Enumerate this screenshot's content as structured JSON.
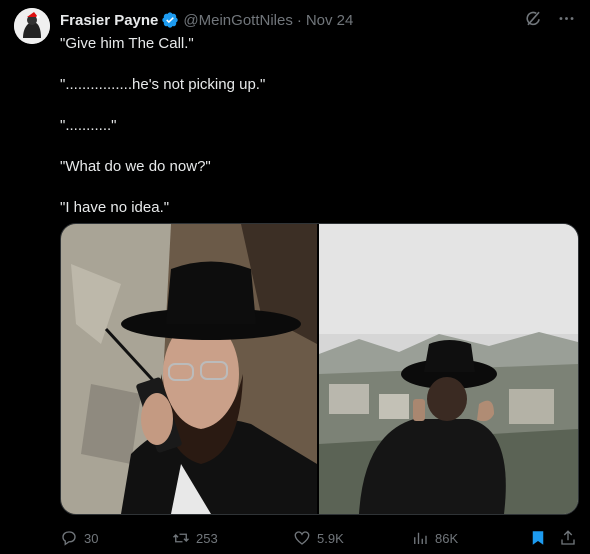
{
  "tweet": {
    "author_name": "Frasier Payne",
    "handle": "@MeinGottNiles",
    "separator": "·",
    "date": "Nov 24",
    "lines": [
      "\"Give him The Call.\"",
      "\"................he's not picking up.\"",
      "\"...........\"",
      "\"What do we do now?\"",
      "\"I have no idea.\""
    ]
  },
  "media": {
    "left_image": "man-in-black-hat-with-walkie-talkie-photo",
    "right_image": "man-in-black-hat-on-phone-overlooking-city-photo"
  },
  "actions": {
    "replies": "30",
    "reposts": "253",
    "likes": "5.9K",
    "views": "86K"
  },
  "colors": {
    "background": "#000000",
    "text": "#e7e9ea",
    "muted": "#71767b",
    "accent": "#1d9bf0"
  }
}
